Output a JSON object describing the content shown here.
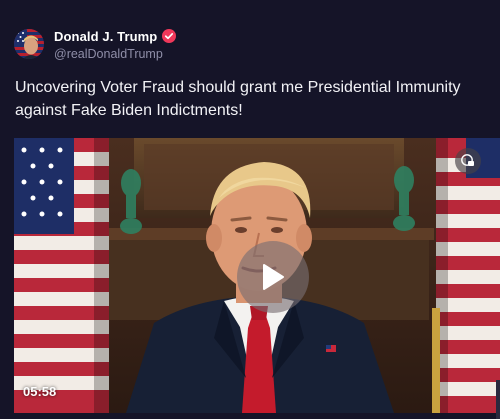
{
  "post": {
    "author": {
      "display_name": "Donald J. Trump",
      "handle": "@realDonaldTrump",
      "verified": true,
      "verified_color": "#f0385a",
      "avatar_icon": "flag-portrait-avatar"
    },
    "text": "Uncovering Voter Fraud should grant me Presidential Immunity against Fake Biden Indictments!",
    "video": {
      "duration": "05:58",
      "play_icon": "play-icon",
      "pip_icon": "picture-in-picture-icon"
    }
  },
  "colors": {
    "background": "#151428",
    "text": "#f2f2f6",
    "handle": "#8f8ea8"
  }
}
